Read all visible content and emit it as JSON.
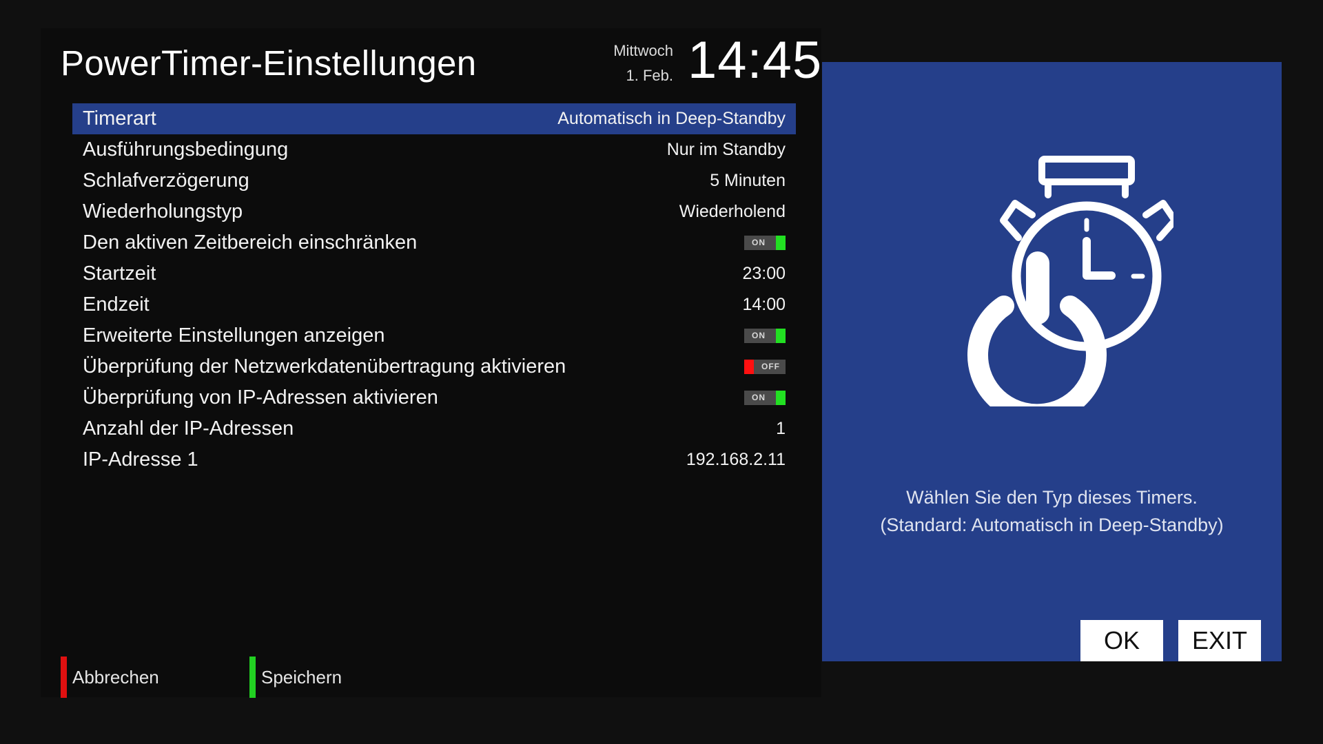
{
  "title": "PowerTimer-Einstellungen",
  "date": {
    "weekday": "Mittwoch",
    "day": "1. Feb."
  },
  "time": "14:45",
  "settings": [
    {
      "label": "Timerart",
      "value": "Automatisch in Deep-Standby",
      "selected": true
    },
    {
      "label": "Ausführungsbedingung",
      "value": "Nur im Standby"
    },
    {
      "label": "Schlafverzögerung",
      "value": "5 Minuten"
    },
    {
      "label": "Wiederholungstyp",
      "value": "Wiederholend"
    },
    {
      "label": "Den aktiven Zeitbereich einschränken",
      "toggle": "ON"
    },
    {
      "label": "Startzeit",
      "value": "23:00"
    },
    {
      "label": "Endzeit",
      "value": "14:00"
    },
    {
      "label": "Erweiterte Einstellungen anzeigen",
      "toggle": "ON"
    },
    {
      "label": "Überprüfung der Netzwerkdatenübertragung aktivieren",
      "toggle": "OFF"
    },
    {
      "label": "Überprüfung von IP-Adressen aktivieren",
      "toggle": "ON"
    },
    {
      "label": "Anzahl der IP-Adressen",
      "value": "1"
    },
    {
      "label": "IP-Adresse 1",
      "value": "192.168.2.11"
    }
  ],
  "footer": {
    "cancel_label": "Abbrechen",
    "save_label": "Speichern"
  },
  "help": {
    "line1": "Wählen Sie den Typ dieses Timers.",
    "line2": "(Standard: Automatisch in Deep-Standby)",
    "icon": "power-timer-icon"
  },
  "keys": {
    "ok": "OK",
    "exit": "EXIT"
  },
  "colors": {
    "accent_blue": "#253f8a",
    "toggle_on": "#22e022",
    "toggle_off": "#ff1010",
    "cancel_red": "#e01010",
    "save_green": "#22d022"
  }
}
